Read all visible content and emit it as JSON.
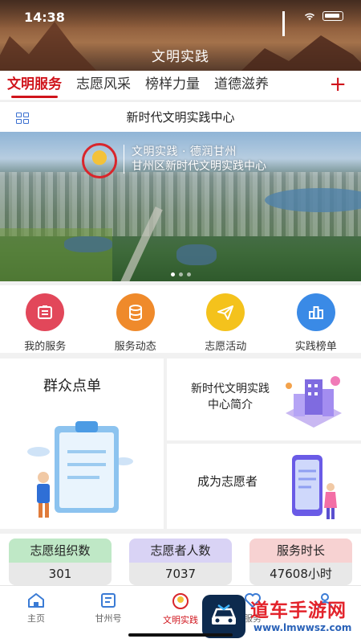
{
  "status_bar": {
    "time": "14:38"
  },
  "header": {
    "title": "文明实践"
  },
  "tabs": [
    {
      "label": "文明服务",
      "active": true
    },
    {
      "label": "志愿风采",
      "active": false
    },
    {
      "label": "榜样力量",
      "active": false
    },
    {
      "label": "道德滋养",
      "active": false
    }
  ],
  "tab_add_label": "+",
  "section": {
    "title": "新时代文明实践中心"
  },
  "banner": {
    "line1": "文明实践 · 德润甘州",
    "line2": "甘州区新时代文明实践中心"
  },
  "quick_links": [
    {
      "label": "我的服务",
      "icon": "document-icon",
      "color": "#e2475a"
    },
    {
      "label": "服务动态",
      "icon": "database-icon",
      "color": "#ef8a2b"
    },
    {
      "label": "志愿活动",
      "icon": "paper-plane-icon",
      "color": "#f4c21c"
    },
    {
      "label": "实践榜单",
      "icon": "ranking-icon",
      "color": "#3a8ae6"
    }
  ],
  "cards": {
    "left": {
      "title": "群众点单"
    },
    "right_top": {
      "title": "新时代文明实践中心简介"
    },
    "right_bottom": {
      "title": "成为志愿者"
    }
  },
  "stats": [
    {
      "label": "志愿组织数",
      "value": "301",
      "color": "#bfe8c6"
    },
    {
      "label": "志愿者人数",
      "value": "7037",
      "color": "#d9d3f5"
    },
    {
      "label": "服务时长",
      "value": "47608小时",
      "color": "#f7d2d2"
    }
  ],
  "bottom_nav": [
    {
      "label": "主页",
      "icon": "home-icon"
    },
    {
      "label": "甘州号",
      "icon": "news-icon"
    },
    {
      "label": "文明实践",
      "icon": "civilization-logo-icon",
      "active": true
    },
    {
      "label": "服务",
      "icon": "heart-icon"
    },
    {
      "label": "",
      "icon": "person-icon"
    }
  ],
  "watermark": {
    "title": "道车手游网",
    "url": "www.lmwwsz.com"
  }
}
